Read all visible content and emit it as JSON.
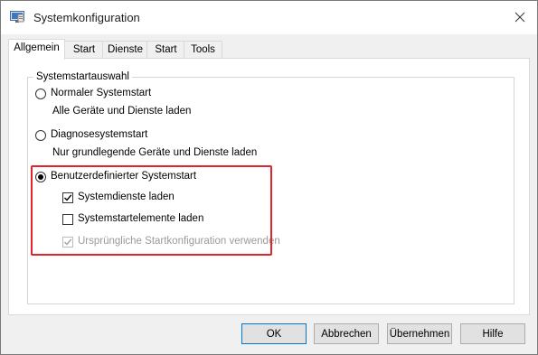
{
  "window": {
    "title": "Systemkonfiguration",
    "title_icon": "msconfig-icon",
    "close_icon": "close-icon"
  },
  "tabs": [
    {
      "label": "Allgemein",
      "active": true
    },
    {
      "label": "Start",
      "active": false
    },
    {
      "label": "Dienste",
      "active": false
    },
    {
      "label": "Start",
      "active": false
    },
    {
      "label": "Tools",
      "active": false
    }
  ],
  "startup_group": {
    "legend": "Systemstartauswahl",
    "options": [
      {
        "label": "Normaler Systemstart",
        "description": "Alle Geräte und Dienste laden",
        "selected": false
      },
      {
        "label": "Diagnosesystemstart",
        "description": "Nur grundlegende Geräte und Dienste laden",
        "selected": false
      },
      {
        "label": "Benutzerdefinierter Systemstart",
        "selected": true
      }
    ],
    "custom_options": [
      {
        "label": "Systemdienste laden",
        "checked": true,
        "enabled": true
      },
      {
        "label": "Systemstartelemente laden",
        "checked": false,
        "enabled": true
      },
      {
        "label": "Ursprüngliche Startkonfiguration verwenden",
        "checked": true,
        "enabled": false
      }
    ]
  },
  "highlight_color": "#e0242a",
  "buttons": {
    "ok": "OK",
    "cancel": "Abbrechen",
    "apply": "Übernehmen",
    "help": "Hilfe"
  }
}
